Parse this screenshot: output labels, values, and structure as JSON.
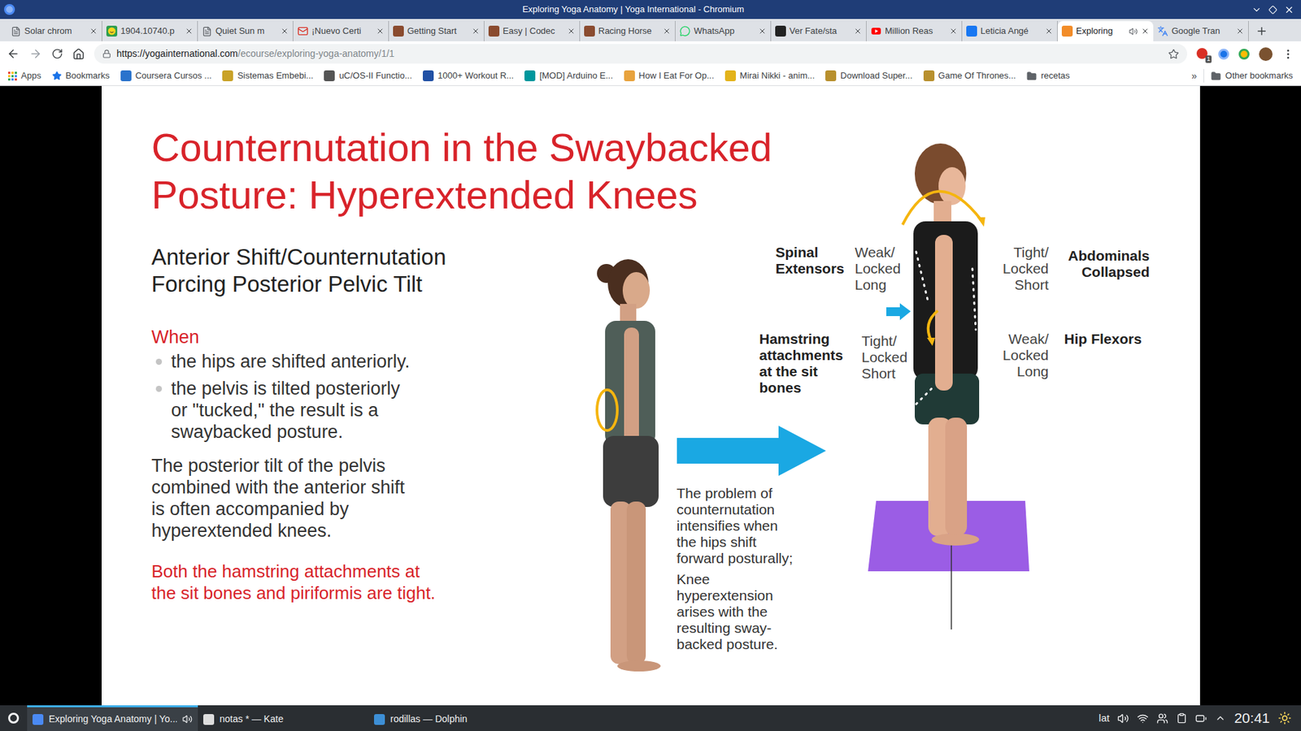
{
  "window": {
    "title": "Exploring Yoga Anatomy | Yoga International - Chromium"
  },
  "tabs": [
    {
      "label": "Solar chrom",
      "kind": "doc",
      "selected": false,
      "audio": false
    },
    {
      "label": "1904.10740.p",
      "kind": "smiley",
      "selected": false,
      "audio": false
    },
    {
      "label": "Quiet Sun m",
      "kind": "doc",
      "selected": false,
      "audio": false
    },
    {
      "label": "¡Nuevo Certi",
      "kind": "gmail",
      "selected": false,
      "audio": false
    },
    {
      "label": "Getting Start",
      "kind": "cc",
      "selected": false,
      "audio": false
    },
    {
      "label": "Easy | Codec",
      "kind": "cc",
      "selected": false,
      "audio": false
    },
    {
      "label": "Racing Horse",
      "kind": "cc",
      "selected": false,
      "audio": false
    },
    {
      "label": "WhatsApp",
      "kind": "whatsapp",
      "selected": false,
      "audio": false
    },
    {
      "label": "Ver Fate/sta",
      "kind": "af",
      "selected": false,
      "audio": false
    },
    {
      "label": "Million Reas",
      "kind": "youtube",
      "selected": false,
      "audio": false
    },
    {
      "label": "Leticia Angé",
      "kind": "facebook",
      "selected": false,
      "audio": false
    },
    {
      "label": "Exploring",
      "kind": "yoga",
      "selected": true,
      "audio": true
    },
    {
      "label": "Google Tran",
      "kind": "translate",
      "selected": false,
      "audio": false
    }
  ],
  "toolbar": {
    "url_host": "https://yogainternational.com",
    "url_path": "/ecourse/exploring-yoga-anatomy/1/1",
    "extension_badge": "1"
  },
  "bookmarks": [
    {
      "label": "Apps",
      "kind": "apps"
    },
    {
      "label": "Bookmarks",
      "kind": "star"
    },
    {
      "label": "Coursera Cursos ...",
      "kind": "coursera"
    },
    {
      "label": "Sistemas Embebi...",
      "kind": "emb"
    },
    {
      "label": "uC/OS-II Functio...",
      "kind": "gear"
    },
    {
      "label": "1000+ Workout R...",
      "kind": "workout"
    },
    {
      "label": "[MOD] Arduino E...",
      "kind": "arduino"
    },
    {
      "label": "How I Eat For Op...",
      "kind": "food"
    },
    {
      "label": "Mirai Nikki - anim...",
      "kind": "anime"
    },
    {
      "label": "Download Super...",
      "kind": "shield"
    },
    {
      "label": "Game Of Thrones...",
      "kind": "shield"
    },
    {
      "label": "recetas",
      "kind": "folder"
    }
  ],
  "bookmarks_overflow": "»",
  "other_bookmarks": "Other bookmarks",
  "slide": {
    "title_lines": [
      "Counternutation in the Swaybacked",
      "Posture: Hyperextended Knees"
    ],
    "subtitle_lines": [
      "Anterior Shift/Counternutation",
      "Forcing Posterior Pelvic Tilt"
    ],
    "when": "When",
    "bullets": [
      {
        "lines": [
          "the hips are shifted anteriorly."
        ]
      },
      {
        "lines": [
          "the pelvis is tilted posteriorly",
          "or \"tucked,\" the result is a",
          "swaybacked posture."
        ]
      }
    ],
    "paragraph_lines": [
      "The posterior tilt of the pelvis",
      "combined with the anterior shift",
      "is often accompanied by",
      "hyperextended knees."
    ],
    "note_lines": [
      "Both the hamstring attachments at",
      "the sit bones and piriformis are tight."
    ],
    "caption": [
      [
        "The problem of",
        "counternutation",
        "intensifies when",
        "the hips shift",
        "forward posturally;"
      ],
      [
        "Knee",
        "hyperextension",
        "arises with the",
        "resulting sway-",
        "backed posture."
      ]
    ],
    "labels": [
      {
        "lines": [
          "Spinal",
          "Extensors"
        ],
        "kind": "muscle"
      },
      {
        "lines": [
          "Weak/",
          "Locked",
          "Long"
        ],
        "kind": "state"
      },
      {
        "lines": [
          "Tight/",
          "Locked",
          "Short"
        ],
        "kind": "state"
      },
      {
        "lines": [
          "Abdominals",
          "Collapsed"
        ],
        "kind": "muscle"
      },
      {
        "lines": [
          "Hamstring",
          "attachments",
          "at the sit",
          "bones"
        ],
        "kind": "muscle"
      },
      {
        "lines": [
          "Tight/",
          "Locked",
          "Short"
        ],
        "kind": "state"
      },
      {
        "lines": [
          "Weak/",
          "Locked",
          "Long"
        ],
        "kind": "state"
      },
      {
        "lines": [
          "Hip Flexors"
        ],
        "kind": "muscle"
      }
    ]
  },
  "taskbar": {
    "tasks": [
      {
        "label": "Exploring Yoga Anatomy | Yo...",
        "kind": "chromium",
        "selected": true,
        "audio": true
      },
      {
        "label": "notas * — Kate",
        "kind": "kate",
        "selected": false,
        "audio": false
      },
      {
        "label": "rodillas — Dolphin",
        "kind": "dolphin",
        "selected": false,
        "audio": false
      }
    ],
    "keyboard_layout": "lat",
    "clock": "20:41"
  }
}
